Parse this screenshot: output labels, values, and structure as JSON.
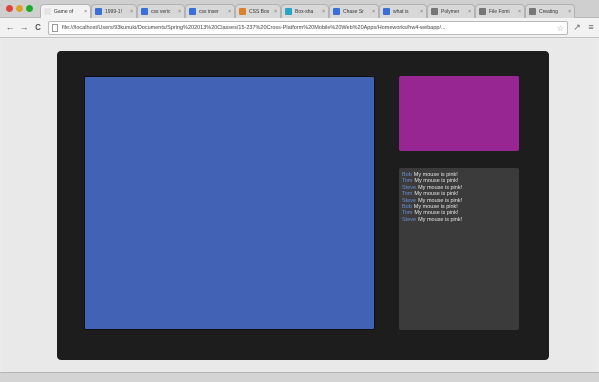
{
  "browser": {
    "tabs": [
      {
        "label": "Game of",
        "favicon_color": "#e5e5e5",
        "active": true
      },
      {
        "label": "1999-1!",
        "favicon_color": "#3a6fd8"
      },
      {
        "label": "css veric",
        "favicon_color": "#3a6fd8"
      },
      {
        "label": "css inser",
        "favicon_color": "#3a6fd8"
      },
      {
        "label": "CSS Box",
        "favicon_color": "#d9822b"
      },
      {
        "label": "Box-sha",
        "favicon_color": "#2aa3c9"
      },
      {
        "label": "Chase Sr",
        "favicon_color": "#3a6fd8"
      },
      {
        "label": "what is",
        "favicon_color": "#3a6fd8"
      },
      {
        "label": "Polymer",
        "favicon_color": "#777777"
      },
      {
        "label": "File Fomi",
        "favicon_color": "#777777"
      },
      {
        "label": "Creating",
        "favicon_color": "#777777"
      }
    ],
    "tab_close_glyph": "×",
    "toolbar": {
      "back": "←",
      "forward": "→",
      "reload": "C",
      "url": "file:///localhost/Users/93kunuki/Documents/Spring%202013%20Classes/15-237%20Cross-Platform%20Mobile%20Web%20Apps/Homeworks/hw4-webapp/...",
      "star": "☆",
      "extension": "↗",
      "menu": "≡"
    }
  },
  "app": {
    "colors": {
      "frame": "#1d1d1d",
      "canvas": "#4263b5",
      "swatch": "#972592",
      "log_bg": "#3b3b3b"
    },
    "log": [
      {
        "who": "Bob",
        "msg": "My mouse is pink!"
      },
      {
        "who": "Tom",
        "msg": "My mouse is pink!"
      },
      {
        "who": "Steve",
        "msg": "My mouse is pink!"
      },
      {
        "who": "Tom",
        "msg": "My mouse is pink!"
      },
      {
        "who": "Steve",
        "msg": "My mouse is pink!"
      },
      {
        "who": "Bob",
        "msg": "My mouse is pink!"
      },
      {
        "who": "Tom",
        "msg": "My mouse is pink!"
      },
      {
        "who": "Steve",
        "msg": "My mouse is pink!"
      }
    ]
  }
}
